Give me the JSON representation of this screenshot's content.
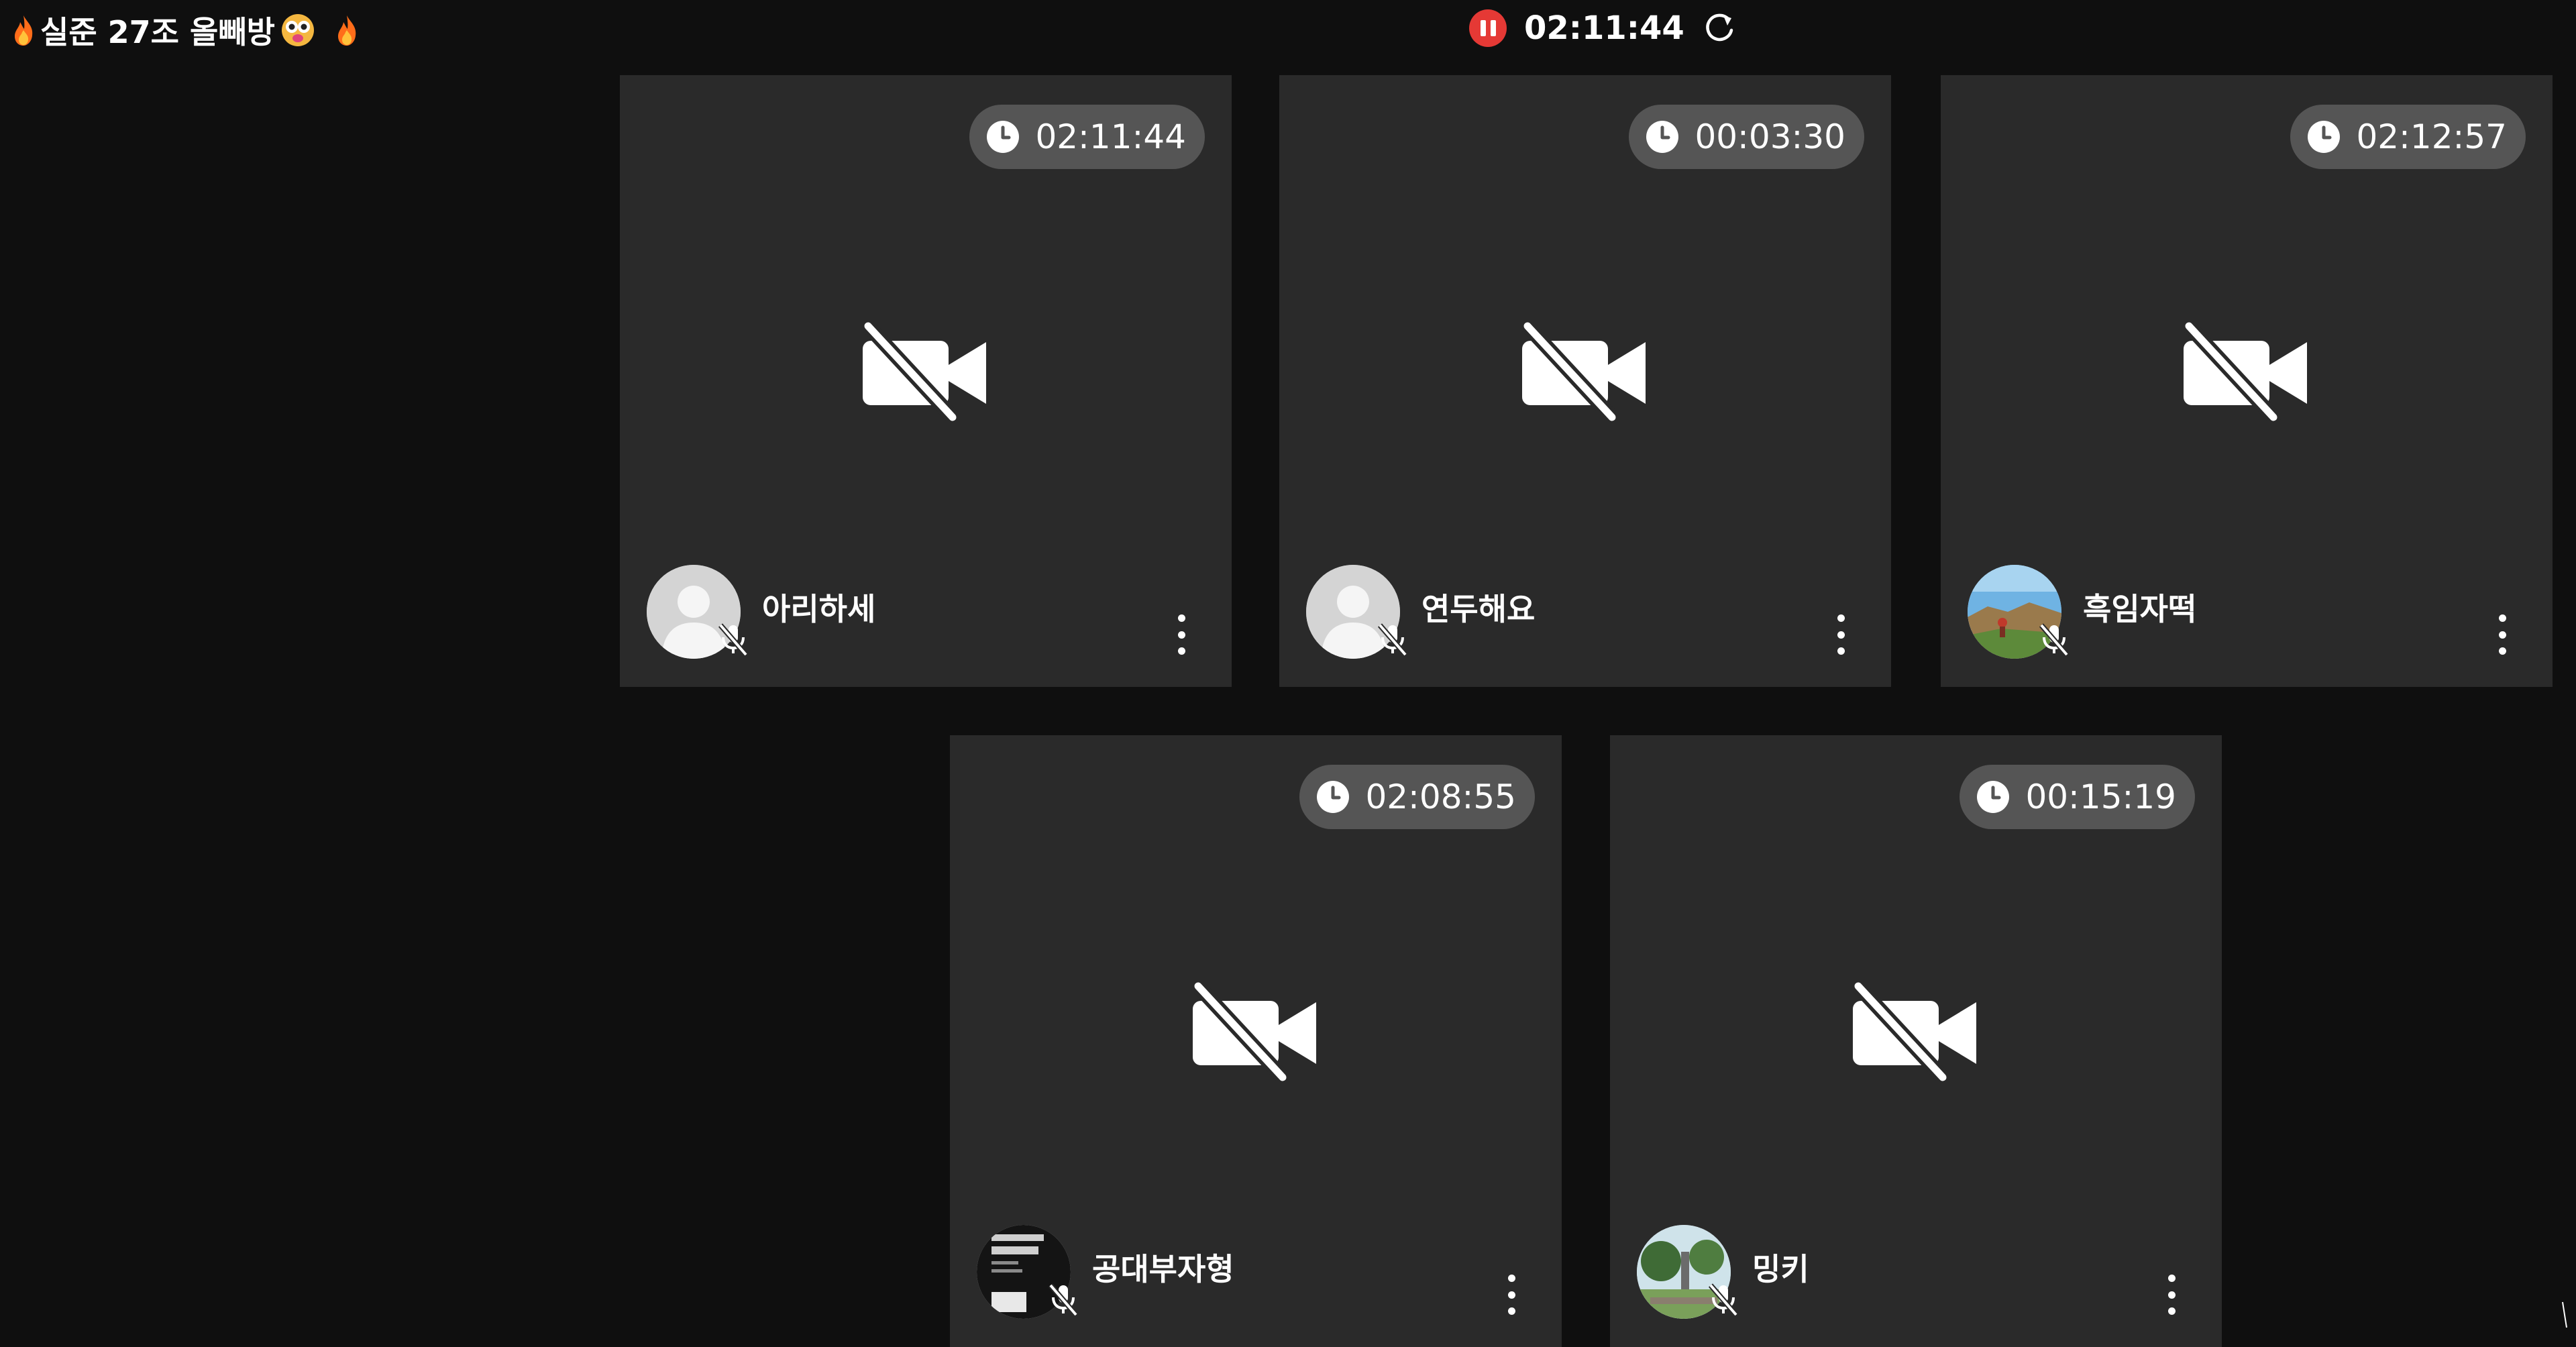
{
  "header": {
    "room_title": "실준 27조 올빼방",
    "session_timer": "02:11:44",
    "icons": [
      "fire-icon",
      "owl-face-icon",
      "pause-icon",
      "refresh-icon"
    ],
    "accent_color": "#e53935"
  },
  "tiles": [
    {
      "name": "아리하세",
      "timer": "02:11:44",
      "avatar": "default-avatar-icon",
      "camera": "off",
      "mic": "off"
    },
    {
      "name": "연두해요",
      "timer": "00:03:30",
      "avatar": "default-avatar-icon",
      "camera": "off",
      "mic": "off"
    },
    {
      "name": "흑임자떡",
      "timer": "02:12:57",
      "avatar": "landscape-photo",
      "camera": "off",
      "mic": "off"
    },
    {
      "name": "공대부자형",
      "timer": "02:08:55",
      "avatar": "book-cover-photo",
      "camera": "off",
      "mic": "off"
    },
    {
      "name": "밍키",
      "timer": "00:15:19",
      "avatar": "garden-photo",
      "camera": "off",
      "mic": "off"
    }
  ],
  "colors": {
    "background": "#0f0f0f",
    "tile": "#2a2a2a",
    "timer_pill": "#555555"
  }
}
